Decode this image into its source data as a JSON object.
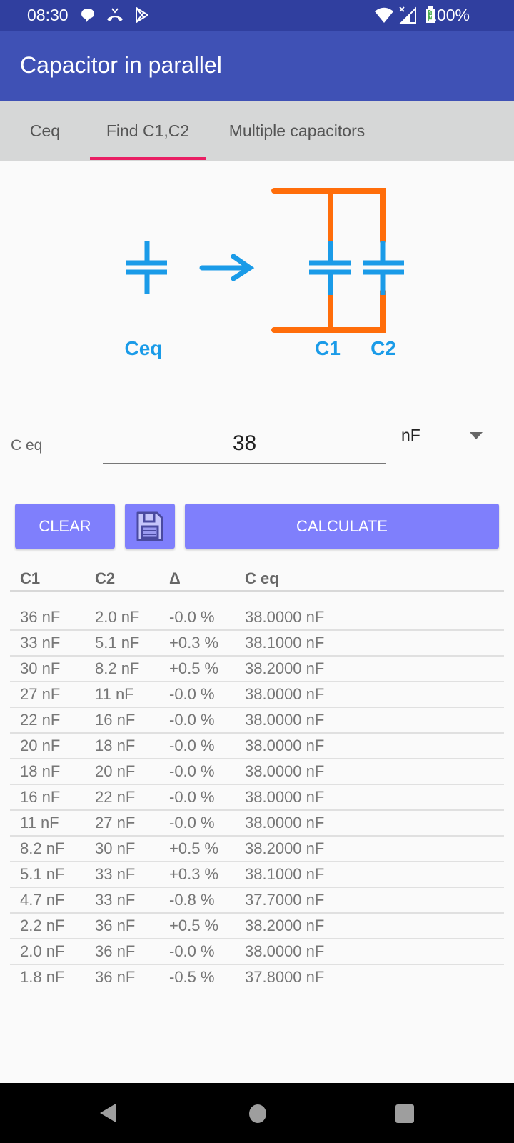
{
  "status_bar": {
    "time": "08:30",
    "left_icons": [
      "chat-bubble-icon",
      "missed-call-icon",
      "play-store-icon"
    ],
    "right_icons": [
      "wifi-icon",
      "signal-icon",
      "battery-charging-icon"
    ],
    "battery": "100%"
  },
  "app_bar": {
    "title": "Capacitor in parallel"
  },
  "tabs": [
    {
      "label": "Ceq",
      "active": false
    },
    {
      "label": "Find C1,C2",
      "active": true
    },
    {
      "label": "Multiple capacitors",
      "active": false
    }
  ],
  "diagram": {
    "left_label": "Ceq",
    "right_labels": [
      "C1",
      "C2"
    ],
    "colors": {
      "capacitor": "#1a9be8",
      "wire": "#ff6d0a"
    }
  },
  "form": {
    "label": "C eq",
    "value": "38",
    "unit": "nF"
  },
  "buttons": {
    "clear": "CLEAR",
    "save_icon": "floppy-disk-icon",
    "calculate": "CALCULATE",
    "color": "#7f7ffc"
  },
  "table": {
    "headers": [
      "C1",
      "C2",
      "Δ",
      "C eq"
    ],
    "rows": [
      [
        "36 nF",
        "2.0 nF",
        "-0.0 %",
        "38.0000 nF"
      ],
      [
        "33 nF",
        "5.1 nF",
        "+0.3 %",
        "38.1000 nF"
      ],
      [
        "30 nF",
        "8.2 nF",
        "+0.5 %",
        "38.2000 nF"
      ],
      [
        "27 nF",
        "11 nF",
        "-0.0 %",
        "38.0000 nF"
      ],
      [
        "22 nF",
        "16 nF",
        "-0.0 %",
        "38.0000 nF"
      ],
      [
        "20 nF",
        "18 nF",
        "-0.0 %",
        "38.0000 nF"
      ],
      [
        "18 nF",
        "20 nF",
        "-0.0 %",
        "38.0000 nF"
      ],
      [
        "16 nF",
        "22 nF",
        "-0.0 %",
        "38.0000 nF"
      ],
      [
        "11 nF",
        "27 nF",
        "-0.0 %",
        "38.0000 nF"
      ],
      [
        "8.2 nF",
        "30 nF",
        "+0.5 %",
        "38.2000 nF"
      ],
      [
        "5.1 nF",
        "33 nF",
        "+0.3 %",
        "38.1000 nF"
      ],
      [
        "4.7 nF",
        "33 nF",
        "-0.8 %",
        "37.7000 nF"
      ],
      [
        "2.2 nF",
        "36 nF",
        "+0.5 %",
        "38.2000 nF"
      ],
      [
        "2.0 nF",
        "36 nF",
        "-0.0 %",
        "38.0000 nF"
      ],
      [
        "1.8 nF",
        "36 nF",
        "-0.5 %",
        "37.8000 nF"
      ]
    ]
  },
  "nav_bar": {
    "icons": [
      "back-icon",
      "home-icon",
      "recents-icon"
    ]
  }
}
